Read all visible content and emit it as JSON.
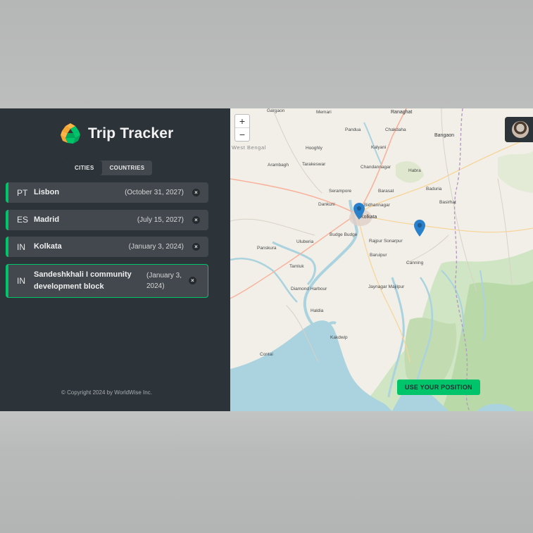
{
  "app": {
    "title": "Trip Tracker",
    "tabs": [
      {
        "label": "Cities",
        "active": true
      },
      {
        "label": "Countries",
        "active": false
      }
    ],
    "cities": [
      {
        "code": "PT",
        "name": "Lisbon",
        "date": "(October 31, 2027)"
      },
      {
        "code": "ES",
        "name": "Madrid",
        "date": "(July 15, 2027)"
      },
      {
        "code": "IN",
        "name": "Kolkata",
        "date": "(January 3, 2024)"
      },
      {
        "code": "IN",
        "name": "Sandeshkhali I community development block",
        "date": "(January 3, 2024)",
        "active": true
      }
    ],
    "delete_symbol": "×",
    "footer": "© Copyright 2024 by WorldWise Inc.",
    "accent_color": "#00c46a"
  },
  "map": {
    "zoom_in": "+",
    "zoom_out": "−",
    "geolocate_label": "Use your position",
    "places": {
      "garui": "Gargaon",
      "memari": "Memari",
      "ranaghat": "Ranaghat",
      "pandua": "Pandua",
      "chakdaha": "Chakdaha",
      "bangaon": "Bangaon",
      "westbengal": "West Bengal",
      "kalyani": "Kalyani",
      "hooghly": "Hooghly",
      "tarakeswar": "Tarakeswar",
      "arambagh": "Arambagh",
      "chandannagar": "Chandannagar",
      "habra": "Habra",
      "serampore": "Serampore",
      "barasat": "Barasat",
      "baduria": "Baduria",
      "dankuni": "Dankuni",
      "basirhat": "Basirhat",
      "kolkata": "Kolkata",
      "bidhannagar": "Bidhannagar",
      "budgebudge": "Budge Budge",
      "uluberia": "Uluberia",
      "rajpursonarpur": "Rajpur Sonarpur",
      "panskura": "Panskura",
      "baruipur": "Baruipur",
      "canning": "Canning",
      "tamluk": "Tamluk",
      "diamondharbour": "Diamond Harbour",
      "jaynagar": "Jaynagar Majilpur",
      "haldia": "Haldia",
      "kakdwip": "Kakdwip",
      "contai": "Contai",
      "haldia2": "Haldia"
    }
  }
}
